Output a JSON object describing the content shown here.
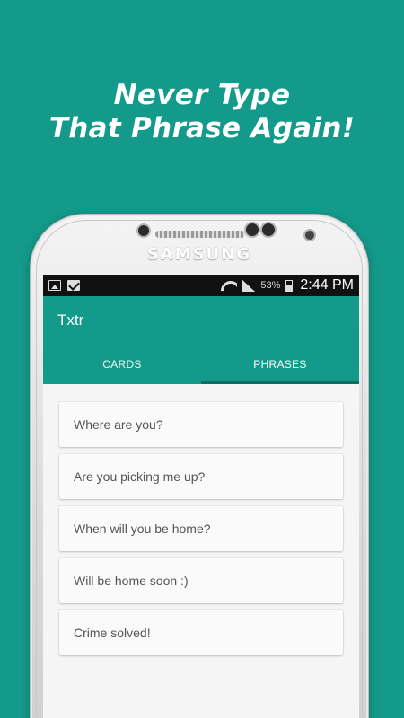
{
  "promo": {
    "line1": "Never Type",
    "line2": "That Phrase Again!"
  },
  "device": {
    "brand": "SAMSUNG"
  },
  "status_bar": {
    "left_icons": [
      "image-icon",
      "gmail-icon"
    ],
    "battery_percent": "53%",
    "time": "2:44 PM"
  },
  "app": {
    "title": "Txtr",
    "accent_color": "#149a8a",
    "tabs": [
      {
        "label": "CARDS",
        "active": false
      },
      {
        "label": "PHRASES",
        "active": true
      }
    ]
  },
  "phrases": [
    "Where are you?",
    "Are you picking me up?",
    "When will you be home?",
    "Will be home soon :)",
    "Crime solved!"
  ]
}
